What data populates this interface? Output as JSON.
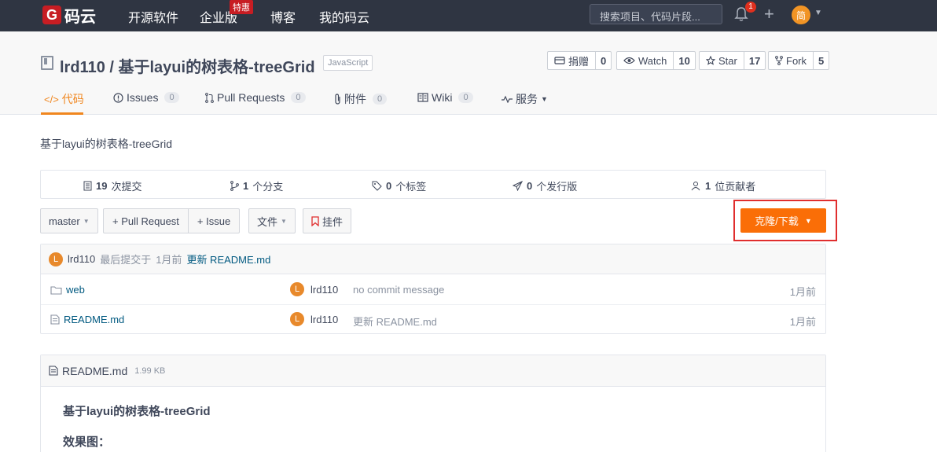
{
  "topnav": {
    "logo_mark": "G",
    "logo_text": "码云",
    "items": [
      "开源软件",
      "企业版",
      "博客",
      "我的码云"
    ],
    "special_badge": "特惠",
    "search_placeholder": "搜索项目、代码片段...",
    "notifications": "1",
    "user_avatar": "简"
  },
  "repo": {
    "title": "lrd110 / 基于layui的树表格-treeGrid",
    "language": "JavaScript",
    "description": "基于layui的树表格-treeGrid"
  },
  "counters": [
    {
      "label": "捐赠",
      "count": "0",
      "icon": "donate-icon"
    },
    {
      "label": "Watch",
      "count": "10",
      "icon": "eye-icon"
    },
    {
      "label": "Star",
      "count": "17",
      "icon": "star-icon"
    },
    {
      "label": "Fork",
      "count": "5",
      "icon": "fork-icon"
    }
  ],
  "tabs": [
    {
      "label": "代码",
      "count": ""
    },
    {
      "label": "Issues",
      "count": "0"
    },
    {
      "label": "Pull Requests",
      "count": "0"
    },
    {
      "label": "附件",
      "count": "0"
    },
    {
      "label": "Wiki",
      "count": "0"
    },
    {
      "label": "服务",
      "count": ""
    }
  ],
  "stats": [
    {
      "num": "19",
      "label": "次提交"
    },
    {
      "num": "1",
      "label": "个分支"
    },
    {
      "num": "0",
      "label": "个标签"
    },
    {
      "num": "0",
      "label": "个发行版"
    },
    {
      "num": "1",
      "label": "位贡献者"
    }
  ],
  "toolbar": {
    "branch": "master",
    "pull_request": "+ Pull Request",
    "issue": "+ Issue",
    "file": "文件",
    "pin": "挂件",
    "clone": "克隆/下载"
  },
  "commit_bar": {
    "avatar": "L",
    "author": "lrd110",
    "text": "最后提交于",
    "time": "1月前",
    "message": "更新 README.md"
  },
  "files": [
    {
      "name": "web",
      "type": "folder",
      "avatar": "L",
      "author": "lrd110",
      "message": "no commit message",
      "time": "1月前"
    },
    {
      "name": "README.md",
      "type": "file",
      "avatar": "L",
      "author": "lrd110",
      "message": "更新 README.md",
      "time": "1月前"
    }
  ],
  "readme": {
    "filename": "README.md",
    "size": "1.99 KB",
    "h1": "基于layui的树表格-treeGrid",
    "h2": "效果图："
  },
  "colors": {
    "nav_bg": "#2f3542",
    "accent": "#f0861e",
    "clone_bg": "#fa6e07",
    "highlight_border": "#e02e2e",
    "brand_red": "#c71d23"
  }
}
